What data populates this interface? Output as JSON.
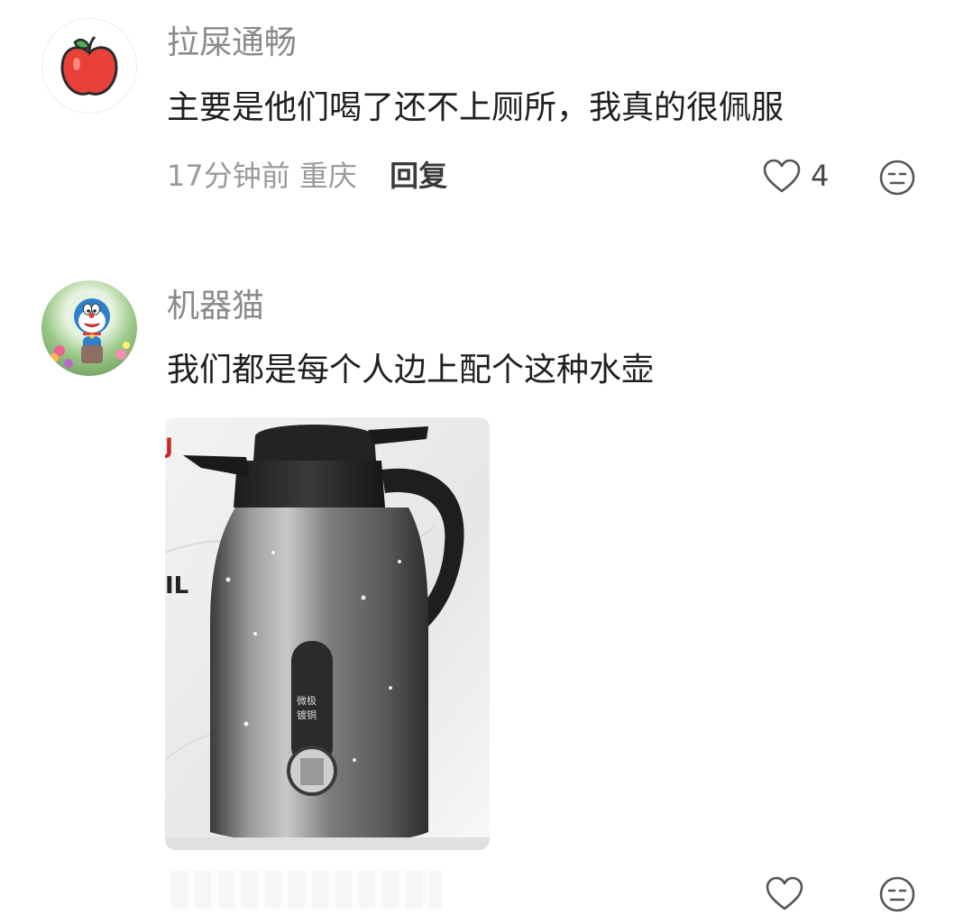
{
  "comments": [
    {
      "username": "拉屎通畅",
      "text": "主要是他们喝了还不上厕所，我真的很佩服",
      "time": "17分钟前",
      "location": "重庆",
      "reply_label": "回复",
      "like_count": "4",
      "avatar_icon": "apple-icon"
    },
    {
      "username": "机器猫",
      "text": "我们都是每个人边上配个这种水壶",
      "avatar_icon": "doraemon-avatar",
      "image_icon": "thermos-kettle-image"
    }
  ],
  "icons": {
    "like": "heart-outline-icon",
    "dislike": "meh-face-icon"
  },
  "colors": {
    "accent": "#e8413a",
    "text": "#1f1f1f",
    "muted": "#8a8a8a"
  }
}
